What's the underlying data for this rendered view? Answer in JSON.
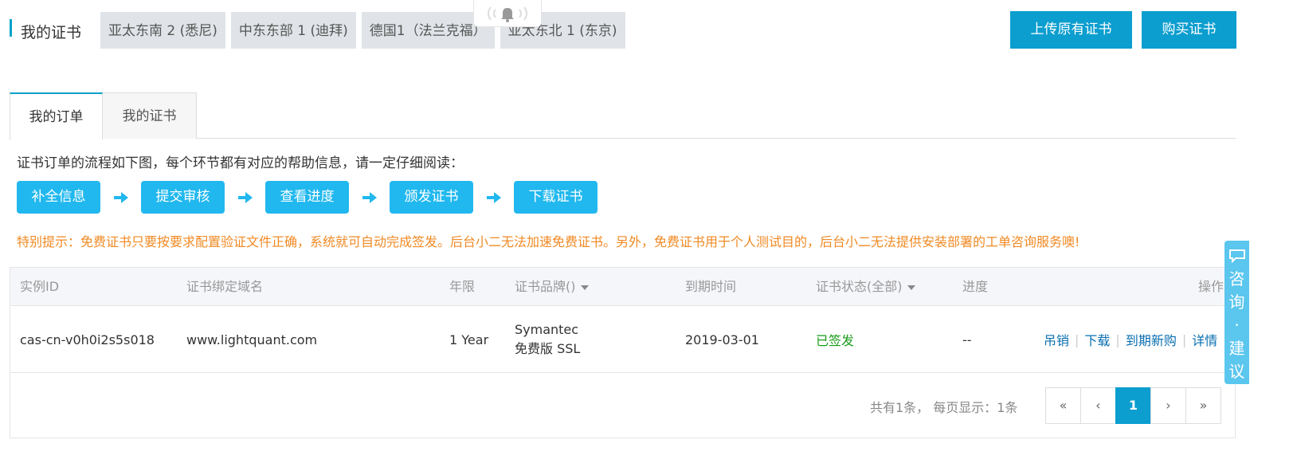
{
  "header": {
    "title": "我的证书",
    "regions": [
      "亚太东南 2 (悉尼)",
      "中东东部 1 (迪拜)",
      "德国1（法兰克福）",
      "亚太东北 1 (东京)"
    ],
    "upload_button": "上传原有证书",
    "buy_button": "购买证书"
  },
  "tabs": {
    "orders": "我的订单",
    "certs": "我的证书"
  },
  "flow": {
    "description": "证书订单的流程如下图，每个环节都有对应的帮助信息，请一定仔细阅读：",
    "steps": [
      "补全信息",
      "提交审核",
      "查看进度",
      "颁发证书",
      "下载证书"
    ]
  },
  "notice": "特别提示：免费证书只要按要求配置验证文件正确，系统就可自动完成签发。后台小二无法加速免费证书。另外，免费证书用于个人测试目的，后台小二无法提供安装部署的工单咨询服务噢!",
  "table": {
    "headers": {
      "instance_id": "实例ID",
      "domain": "证书绑定域名",
      "term": "年限",
      "brand": "证书品牌()",
      "expiry": "到期时间",
      "status": "证书状态(全部)",
      "progress": "进度",
      "actions": "操作"
    },
    "rows": [
      {
        "instance_id": "cas-cn-v0h0i2s5s018",
        "domain": "www.lightquant.com",
        "term": "1 Year",
        "brand_line1": "Symantec",
        "brand_line2": "免费版 SSL",
        "expiry": "2019-03-01",
        "status": "已签发",
        "progress": "--",
        "actions": [
          "吊销",
          "下载",
          "到期新购",
          "详情"
        ]
      }
    ]
  },
  "pagination": {
    "info": "共有1条，  每页显示：1条",
    "first": "«",
    "prev": "‹",
    "current": "1",
    "next": "›",
    "last": "»"
  },
  "consult": {
    "label": "咨询·建议",
    "icon": "chat-icon"
  },
  "colors": {
    "accent": "#0c9ecf",
    "flow_step": "#21b8ef",
    "notice": "#f08a24",
    "status_ok": "#1a9d1a",
    "link": "#0a6fb0"
  }
}
